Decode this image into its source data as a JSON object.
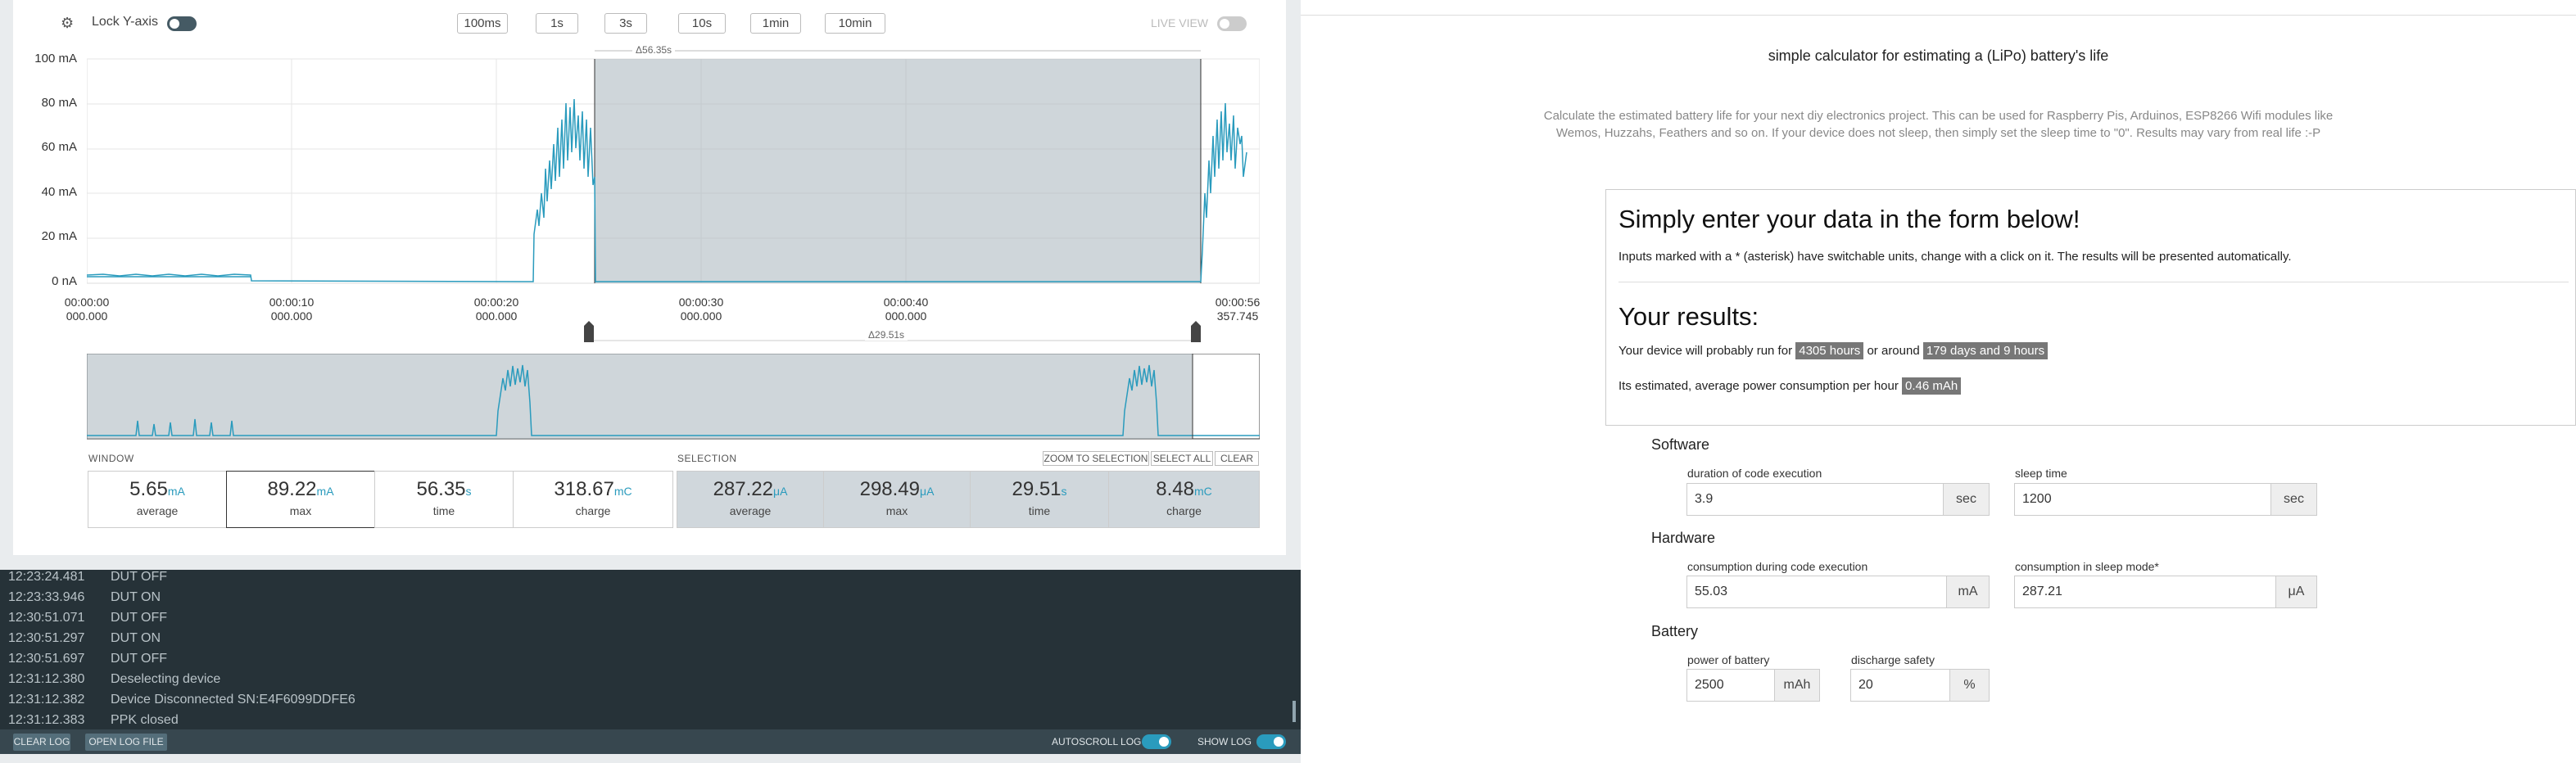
{
  "left_app": {
    "toolbar": {
      "lock_label": "Lock Y-axis",
      "range_buttons": [
        "100ms",
        "1s",
        "3s",
        "10s",
        "1min",
        "10min"
      ],
      "live_view_label": "LIVE VIEW"
    },
    "chart": {
      "y_ticks": [
        "100 mA",
        "80 mA",
        "60 mA",
        "40 mA",
        "20 mA",
        "0 nA"
      ],
      "x_ticks": [
        {
          "t1": "00:00:00",
          "t2": "000.000"
        },
        {
          "t1": "00:00:10",
          "t2": "000.000"
        },
        {
          "t1": "00:00:20",
          "t2": "000.000"
        },
        {
          "t1": "00:00:30",
          "t2": "000.000"
        },
        {
          "t1": "00:00:40",
          "t2": "000.000"
        },
        {
          "t1": "00:00:56",
          "t2": "357.745"
        }
      ],
      "window_delta": "Δ56.35s",
      "selection_delta": "Δ29.51s"
    },
    "window": {
      "label": "WINDOW",
      "stats": [
        {
          "value": "5.65",
          "unit": "mA",
          "label": "average"
        },
        {
          "value": "89.22",
          "unit": "mA",
          "label": "max"
        },
        {
          "value": "56.35",
          "unit": "s",
          "label": "time"
        },
        {
          "value": "318.67",
          "unit": "mC",
          "label": "charge"
        }
      ]
    },
    "selection": {
      "label": "SELECTION",
      "buttons": [
        "ZOOM TO SELECTION",
        "SELECT ALL",
        "CLEAR"
      ],
      "stats": [
        {
          "value": "287.22",
          "unit": "μA",
          "label": "average"
        },
        {
          "value": "298.49",
          "unit": "μA",
          "label": "max"
        },
        {
          "value": "29.51",
          "unit": "s",
          "label": "time"
        },
        {
          "value": "8.48",
          "unit": "mC",
          "label": "charge"
        }
      ]
    },
    "log": [
      {
        "time": "12:23:24.481",
        "msg": "DUT OFF"
      },
      {
        "time": "12:23:33.946",
        "msg": "DUT ON"
      },
      {
        "time": "12:30:51.071",
        "msg": "DUT OFF"
      },
      {
        "time": "12:30:51.297",
        "msg": "DUT ON"
      },
      {
        "time": "12:30:51.697",
        "msg": "DUT OFF"
      },
      {
        "time": "12:31:12.380",
        "msg": "Deselecting device"
      },
      {
        "time": "12:31:12.382",
        "msg": "Device Disconnected SN:E4F6099DDFE6"
      },
      {
        "time": "12:31:12.383",
        "msg": "PPK closed"
      }
    ],
    "log_bar": {
      "clear_log": "CLEAR LOG",
      "open_log_file": "OPEN LOG FILE",
      "autoscroll": "AUTOSCROLL LOG",
      "show_log": "SHOW LOG"
    },
    "colors": {
      "trace": "#2a9bbd",
      "selection": "#a8b4bc",
      "log_bg": "#263238"
    }
  },
  "right_page": {
    "title": "simple calculator for estimating a (LiPo) battery's life",
    "description_1": "Calculate the estimated battery life for your next diy electronics project. This can be used for Raspberry Pis, Arduinos, ESP8266 Wifi modules like",
    "description_2": "Wemos, Huzzahs, Feathers and so on. If your device does not sleep, then simply set the sleep time to \"0\". Results may vary from real life :-P",
    "box": {
      "heading": "Simply enter your data in the form below!",
      "hint": "Inputs marked with a * (asterisk) have switchable units, change with a click on it. The results will be presented automatically.",
      "results_heading": "Your results:",
      "run_prefix": "Your device will probably run for",
      "run_hours": "4305 hours",
      "run_mid": "or around",
      "run_days": "179 days and 9 hours",
      "consumption_prefix": "Its estimated, average power consumption per hour",
      "consumption_value": "0.46 mAh"
    },
    "software": {
      "heading": "Software",
      "duration_label": "duration of code execution",
      "duration_value": "3.9",
      "duration_unit": "sec",
      "sleep_label": "sleep time",
      "sleep_value": "1200",
      "sleep_unit": "sec"
    },
    "hardware": {
      "heading": "Hardware",
      "exec_label": "consumption during code execution",
      "exec_value": "55.03",
      "exec_unit": "mA",
      "sleep_label": "consumption in sleep mode*",
      "sleep_value": "287.21",
      "sleep_unit": "μA"
    },
    "battery": {
      "heading": "Battery",
      "power_label": "power of battery",
      "power_value": "2500",
      "power_unit": "mAh",
      "safety_label": "discharge safety",
      "safety_value": "20",
      "safety_unit": "%"
    }
  }
}
